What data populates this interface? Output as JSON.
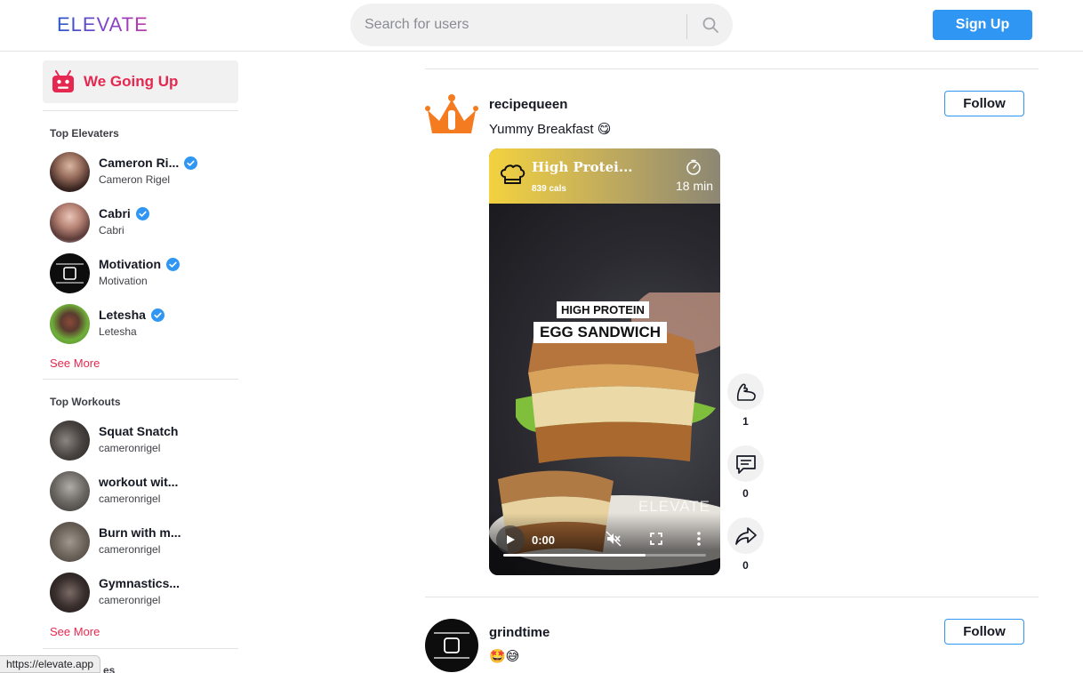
{
  "header": {
    "logo_text": "ELEVATE",
    "search_placeholder": "Search for users",
    "signup_label": "Sign Up"
  },
  "sidebar": {
    "nav_item_label": "We Going Up",
    "top_elevaters_title": "Top Elevaters",
    "top_elevaters": [
      {
        "name": "Cameron Ri...",
        "sub": "Cameron Rigel",
        "verified": true
      },
      {
        "name": "Cabri",
        "sub": "Cabri",
        "verified": true
      },
      {
        "name": "Motivation",
        "sub": "Motivation",
        "verified": true
      },
      {
        "name": "Letesha",
        "sub": "Letesha",
        "verified": true
      }
    ],
    "see_more_1": "See More",
    "top_workouts_title": "Top Workouts",
    "top_workouts": [
      {
        "name": "Squat Snatch",
        "sub": "cameronrigel"
      },
      {
        "name": "workout wit...",
        "sub": "cameronrigel"
      },
      {
        "name": "Burn with m...",
        "sub": "cameronrigel"
      },
      {
        "name": "Gymnastics...",
        "sub": "cameronrigel"
      }
    ],
    "see_more_2": "See More",
    "third_section_partial": "es"
  },
  "feed": {
    "posts": [
      {
        "username": "recipequeen",
        "caption": "Yummy Breakfast 😋",
        "follow_label": "Follow",
        "video": {
          "recipe_title": "High Protei...",
          "recipe_cals": "839 cals",
          "recipe_time": "18 min",
          "overlay_line1": "HIGH PROTEIN",
          "overlay_line2": "EGG SANDWICH",
          "watermark": "ELEVATE",
          "current_time": "0:00",
          "progress_fraction": 0.7
        },
        "actions": {
          "flex_count": "1",
          "comment_count": "0",
          "share_count": "0"
        }
      },
      {
        "username": "grindtime",
        "caption": "🤩😅",
        "follow_label": "Follow"
      }
    ]
  },
  "status_bar": {
    "url": "https://elevate.app"
  },
  "colors": {
    "accent": "#e5284f",
    "primary": "#2f96f4",
    "verified": "#2f96f4"
  }
}
